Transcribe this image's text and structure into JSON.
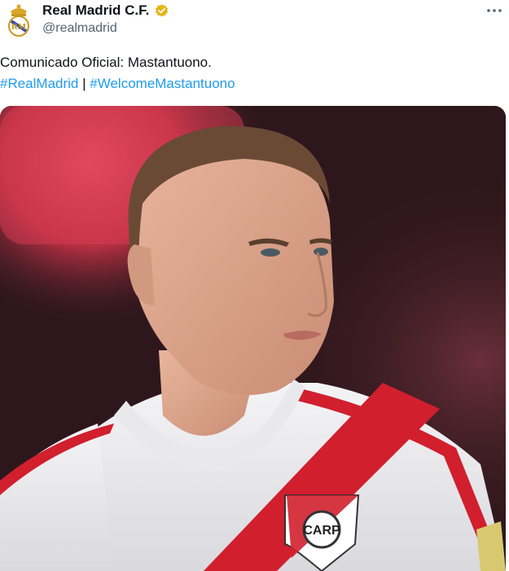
{
  "tweet": {
    "display_name": "Real Madrid C.F.",
    "handle": "@realmadrid",
    "verified_icon": "verified-badge-icon",
    "more_icon": "more-options-icon",
    "text_line": "Comunicado Oficial: Mastantuono.",
    "hashtags": [
      "#RealMadrid",
      "#WelcomeMastantuono"
    ],
    "separator": "|",
    "link_color": "#1d9bf0",
    "media_logo_text": "CARP"
  }
}
